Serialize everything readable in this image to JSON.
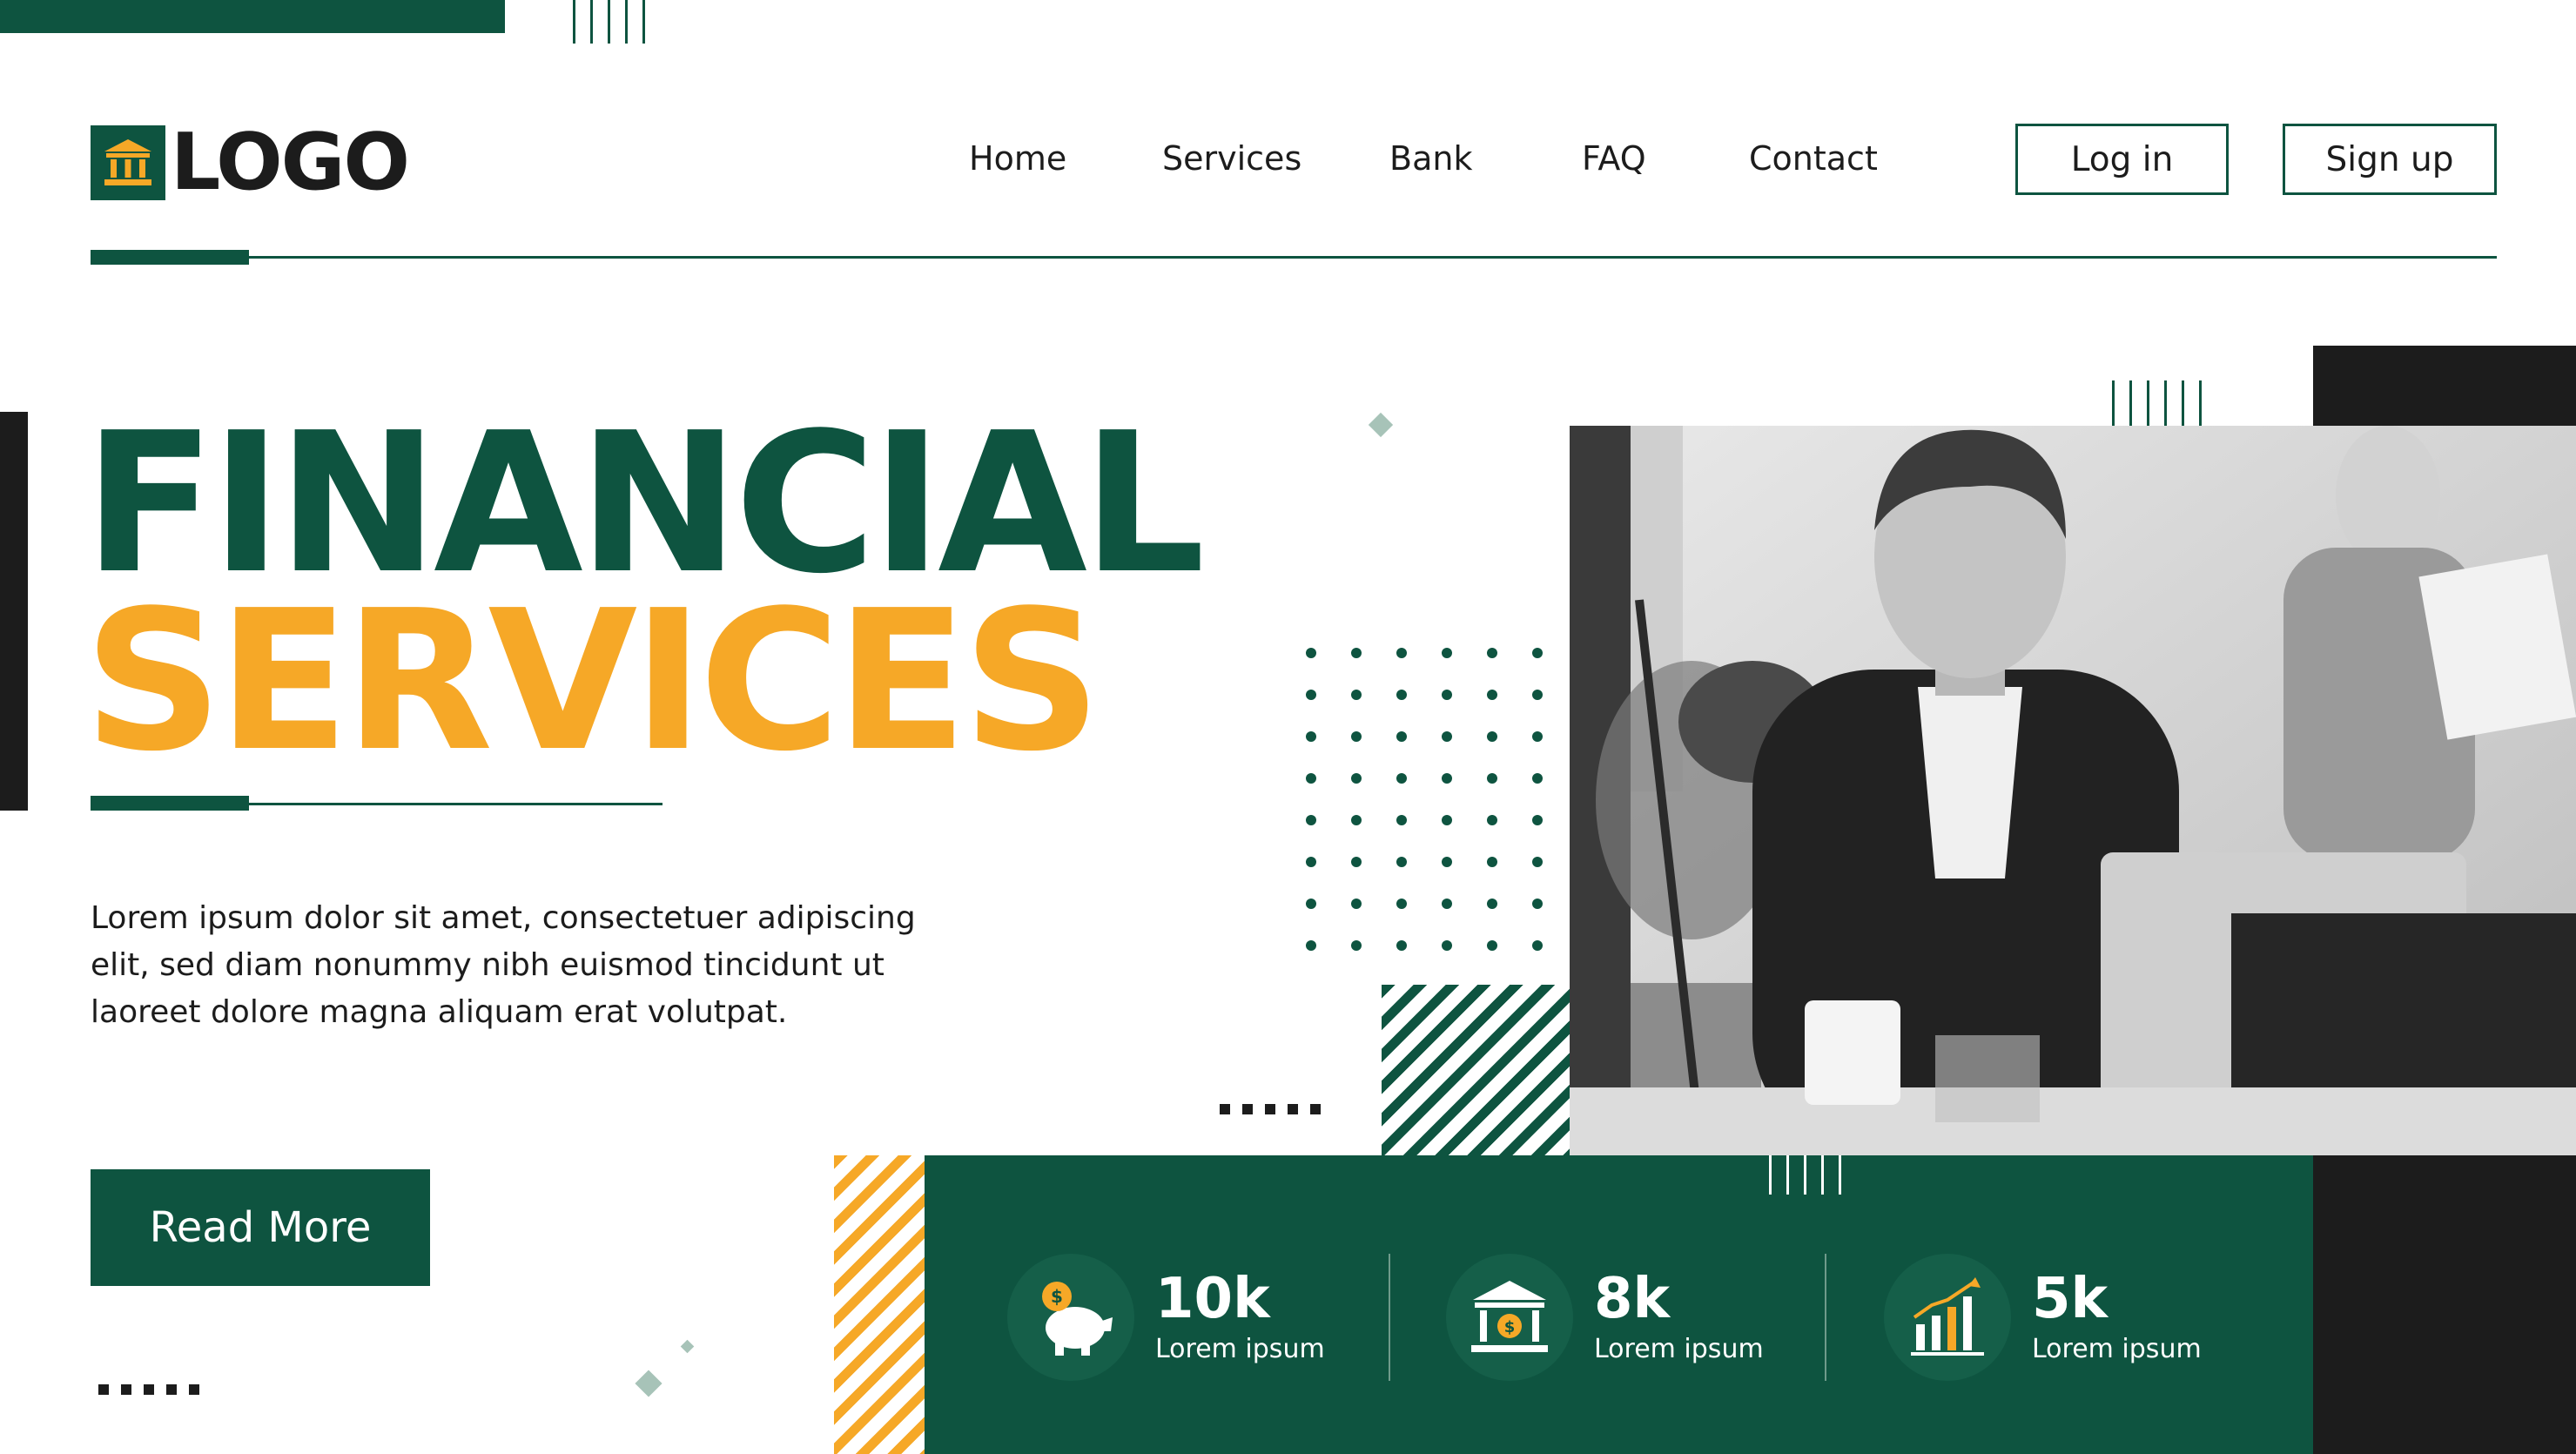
{
  "brand": {
    "logo_text": "LOGO"
  },
  "nav": {
    "items": [
      "Home",
      "Services",
      "Bank",
      "FAQ",
      "Contact"
    ],
    "login": "Log in",
    "signup": "Sign up"
  },
  "hero": {
    "title_line1": "FINANCIAL",
    "title_line2": "SERVICES",
    "body": "Lorem ipsum dolor sit amet, consectetuer adipiscing elit, sed diam nonummy nibh euismod tincidunt ut laoreet dolore magna aliquam erat volutpat.",
    "cta": "Read More"
  },
  "stats": [
    {
      "icon": "piggy-bank-icon",
      "value": "10k",
      "label": "Lorem ipsum"
    },
    {
      "icon": "bank-icon",
      "value": "8k",
      "label": "Lorem ipsum"
    },
    {
      "icon": "growth-chart-icon",
      "value": "5k",
      "label": "Lorem ipsum"
    }
  ],
  "colors": {
    "primary": "#0e5440",
    "accent": "#f6a827",
    "dark": "#1c1c1c"
  }
}
